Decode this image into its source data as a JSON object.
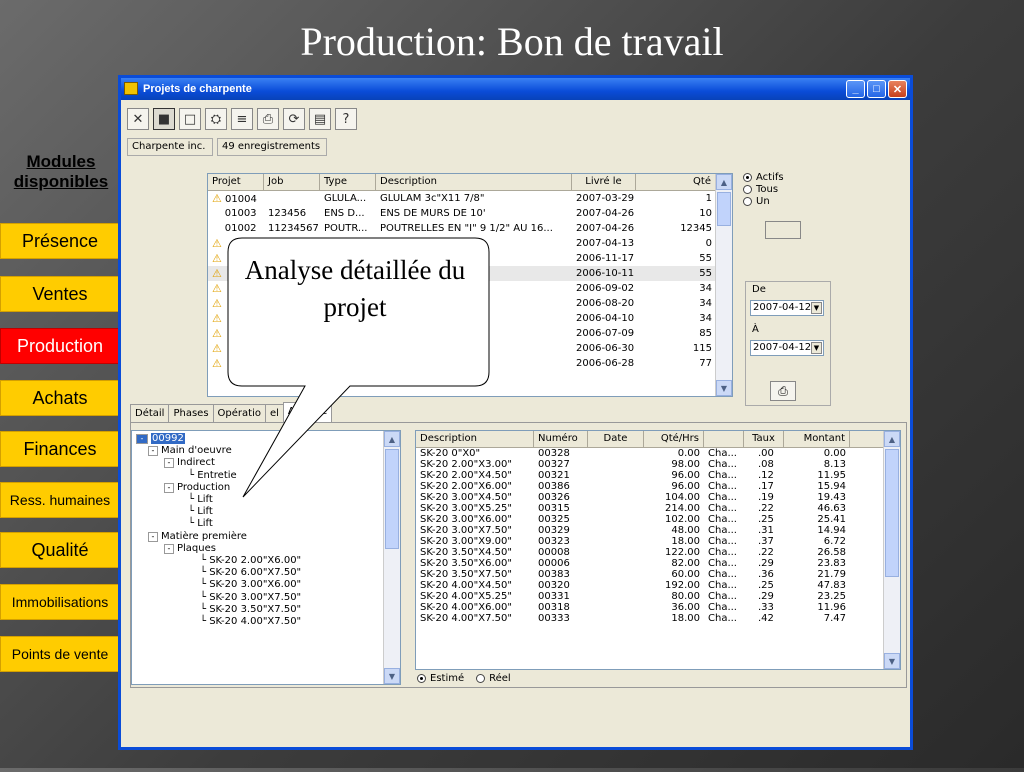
{
  "slide_title": "Production: Bon de travail",
  "modules": {
    "title": "Modules disponibles",
    "items": [
      {
        "label": "Présence",
        "active": false
      },
      {
        "label": "Ventes",
        "active": false
      },
      {
        "label": "Production",
        "active": true
      },
      {
        "label": "Achats",
        "active": false
      },
      {
        "label": "Finances",
        "active": false
      },
      {
        "label": "Ress. humaines",
        "active": false
      },
      {
        "label": "Qualité",
        "active": false
      },
      {
        "label": "Immobilisations",
        "active": false
      },
      {
        "label": "Points de vente",
        "active": false
      }
    ]
  },
  "window": {
    "title": "Projets de charpente",
    "company": "Charpente inc.",
    "record_count": "49 enregistrements"
  },
  "projects": {
    "columns": [
      "Projet",
      "Job",
      "Type",
      "Description",
      "Livré le",
      "Qté"
    ],
    "rows": [
      [
        "01004",
        "",
        "GLULA...",
        "GLULAM 3c\"X11 7/8\"",
        "2007-03-29",
        "1"
      ],
      [
        "01003",
        "123456",
        "ENS D...",
        "ENS DE MURS DE 10'",
        "2007-04-26",
        "10"
      ],
      [
        "01002",
        "11234567",
        "POUTR...",
        "POUTRELLES EN \"I\" 9 1/2\" AU 16...",
        "2007-04-26",
        "12345"
      ],
      [
        "",
        "",
        "",
        "",
        "2007-04-13",
        "0"
      ],
      [
        "",
        "",
        "",
        "",
        "2006-11-17",
        "55"
      ],
      [
        "",
        "",
        "",
        "",
        "2006-10-11",
        "55"
      ],
      [
        "",
        "",
        "",
        "",
        "2006-09-02",
        "34"
      ],
      [
        "",
        "",
        "",
        "",
        "2006-08-20",
        "34"
      ],
      [
        "",
        "",
        "",
        "",
        "2006-04-10",
        "34"
      ],
      [
        "",
        "",
        "",
        "",
        "2006-07-09",
        "85"
      ],
      [
        "",
        "",
        "",
        "",
        "2006-06-30",
        "115"
      ],
      [
        "",
        "",
        "",
        "",
        "2006-06-28",
        "77"
      ]
    ]
  },
  "filter": {
    "options": [
      "Actifs",
      "Tous",
      "Un"
    ],
    "selected": "Actifs",
    "from_label": "De",
    "from_value": "2007-04-12",
    "to_label": "À",
    "to_value": "2007-04-12"
  },
  "tabs": [
    "Détail",
    "Phases",
    "Opératio",
    "el",
    "Analyse"
  ],
  "tree": [
    {
      "label": "00992",
      "level": 0,
      "expander": "-",
      "selected": true
    },
    {
      "label": "Main d'oeuvre",
      "level": 1,
      "expander": "-"
    },
    {
      "label": "Indirect",
      "level": 2,
      "expander": "-"
    },
    {
      "label": "Entretie",
      "level": 3,
      "expander": ""
    },
    {
      "label": "Production",
      "level": 2,
      "expander": "-"
    },
    {
      "label": "Lift",
      "level": 3,
      "expander": ""
    },
    {
      "label": "Lift",
      "level": 3,
      "expander": ""
    },
    {
      "label": "Lift",
      "level": 3,
      "expander": ""
    },
    {
      "label": "Matière première",
      "level": 1,
      "expander": "-"
    },
    {
      "label": "Plaques",
      "level": 2,
      "expander": "-"
    },
    {
      "label": "SK-20 2.00\"X6.00\"",
      "level": 3,
      "expander": ""
    },
    {
      "label": "SK-20 6.00\"X7.50\"",
      "level": 3,
      "expander": ""
    },
    {
      "label": "SK-20 3.00\"X6.00\"",
      "level": 3,
      "expander": ""
    },
    {
      "label": "SK-20 3.00\"X7.50\"",
      "level": 3,
      "expander": ""
    },
    {
      "label": "SK-20 3.50\"X7.50\"",
      "level": 3,
      "expander": ""
    },
    {
      "label": "SK-20 4.00\"X7.50\"",
      "level": 3,
      "expander": ""
    }
  ],
  "analysis": {
    "columns": [
      "Description",
      "Numéro",
      "Date",
      "Qté/Hrs",
      "",
      "Taux",
      "Montant"
    ],
    "rows": [
      [
        "SK-20 0\"X0\"",
        "00328",
        "",
        "0.00",
        "Cha...",
        ".00",
        "0.00"
      ],
      [
        "SK-20 2.00\"X3.00\"",
        "00327",
        "",
        "98.00",
        "Cha...",
        ".08",
        "8.13"
      ],
      [
        "SK-20 2.00\"X4.50\"",
        "00321",
        "",
        "96.00",
        "Cha...",
        ".12",
        "11.95"
      ],
      [
        "SK-20 2.00\"X6.00\"",
        "00386",
        "",
        "96.00",
        "Cha...",
        ".17",
        "15.94"
      ],
      [
        "SK-20 3.00\"X4.50\"",
        "00326",
        "",
        "104.00",
        "Cha...",
        ".19",
        "19.43"
      ],
      [
        "SK-20 3.00\"X5.25\"",
        "00315",
        "",
        "214.00",
        "Cha...",
        ".22",
        "46.63"
      ],
      [
        "SK-20 3.00\"X6.00\"",
        "00325",
        "",
        "102.00",
        "Cha...",
        ".25",
        "25.41"
      ],
      [
        "SK-20 3.00\"X7.50\"",
        "00329",
        "",
        "48.00",
        "Cha...",
        ".31",
        "14.94"
      ],
      [
        "SK-20 3.00\"X9.00\"",
        "00323",
        "",
        "18.00",
        "Cha...",
        ".37",
        "6.72"
      ],
      [
        "SK-20 3.50\"X4.50\"",
        "00008",
        "",
        "122.00",
        "Cha...",
        ".22",
        "26.58"
      ],
      [
        "SK-20 3.50\"X6.00\"",
        "00006",
        "",
        "82.00",
        "Cha...",
        ".29",
        "23.83"
      ],
      [
        "SK-20 3.50\"X7.50\"",
        "00383",
        "",
        "60.00",
        "Cha...",
        ".36",
        "21.79"
      ],
      [
        "SK-20 4.00\"X4.50\"",
        "00320",
        "",
        "192.00",
        "Cha...",
        ".25",
        "47.83"
      ],
      [
        "SK-20 4.00\"X5.25\"",
        "00331",
        "",
        "80.00",
        "Cha...",
        ".29",
        "23.25"
      ],
      [
        "SK-20 4.00\"X6.00\"",
        "00318",
        "",
        "36.00",
        "Cha...",
        ".33",
        "11.96"
      ],
      [
        "SK-20 4.00\"X7.50\"",
        "00333",
        "",
        "18.00",
        "Cha...",
        ".42",
        "7.47"
      ]
    ]
  },
  "mode": {
    "options": [
      "Estimé",
      "Réel"
    ],
    "selected": "Estimé"
  },
  "callout_text": "Analyse détaillée du projet"
}
